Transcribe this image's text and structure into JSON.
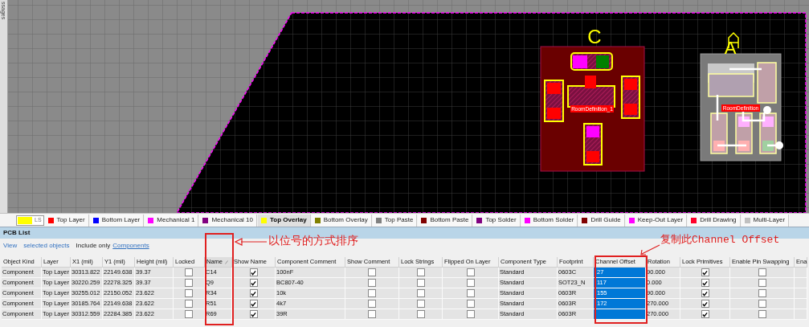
{
  "side_panel": {
    "tab": "ssages"
  },
  "canvas": {
    "components": [
      {
        "kind": "transistor_group",
        "designator": "C",
        "room_label": "RoomDefinition_1",
        "selected": false
      },
      {
        "kind": "resistor_group",
        "designator": "A",
        "room_label": "RoomDefinition",
        "selected": true
      }
    ]
  },
  "current_layer": {
    "label": "LS",
    "color": "#ffff00"
  },
  "layer_tabs": [
    {
      "label": "Top Layer",
      "color": "#ff0000",
      "selected": false
    },
    {
      "label": "Bottom Layer",
      "color": "#0000ff",
      "selected": false
    },
    {
      "label": "Mechanical 1",
      "color": "#ff00ff",
      "selected": false
    },
    {
      "label": "Mechanical 10",
      "color": "#800080",
      "selected": false
    },
    {
      "label": "Top Overlay",
      "color": "#ffff00",
      "selected": true
    },
    {
      "label": "Bottom Overlay",
      "color": "#808000",
      "selected": false
    },
    {
      "label": "Top Paste",
      "color": "#808080",
      "selected": false
    },
    {
      "label": "Bottom Paste",
      "color": "#800000",
      "selected": false
    },
    {
      "label": "Top Solder",
      "color": "#800080",
      "selected": false
    },
    {
      "label": "Bottom Solder",
      "color": "#ff00ff",
      "selected": false
    },
    {
      "label": "Drill Guide",
      "color": "#800000",
      "selected": false
    },
    {
      "label": "Keep-Out Layer",
      "color": "#ff00ff",
      "selected": false
    },
    {
      "label": "Drill Drawing",
      "color": "#ff002a",
      "selected": false
    },
    {
      "label": "Multi-Layer",
      "color": "#c0c0c0",
      "selected": false
    }
  ],
  "panel": {
    "title": "PCB List",
    "filter": {
      "view": "View",
      "scope": "selected objects",
      "include_label": "Include only",
      "include_link": "Components"
    }
  },
  "table": {
    "columns": [
      {
        "label": "Object Kind",
        "kind": "text",
        "sorted": false,
        "selected": false
      },
      {
        "label": "Layer",
        "kind": "text",
        "sorted": false,
        "selected": false
      },
      {
        "label": "X1 (mil)",
        "kind": "text",
        "sorted": false,
        "selected": false
      },
      {
        "label": "Y1 (mil)",
        "kind": "text",
        "sorted": false,
        "selected": false
      },
      {
        "label": "Height (mil)",
        "kind": "text",
        "sorted": false,
        "selected": false
      },
      {
        "label": "Locked",
        "kind": "check",
        "sorted": false,
        "selected": false
      },
      {
        "label": "Name",
        "kind": "text",
        "sorted": true,
        "selected": false
      },
      {
        "label": "Show Name",
        "kind": "check",
        "sorted": false,
        "selected": false
      },
      {
        "label": "Component Comment",
        "kind": "text",
        "sorted": false,
        "selected": false
      },
      {
        "label": "Show Comment",
        "kind": "check",
        "sorted": false,
        "selected": false
      },
      {
        "label": "Lock Strings",
        "kind": "check",
        "sorted": false,
        "selected": false
      },
      {
        "label": "Flipped On Layer",
        "kind": "check",
        "sorted": false,
        "selected": false
      },
      {
        "label": "Component Type",
        "kind": "text",
        "sorted": false,
        "selected": false
      },
      {
        "label": "Footprint",
        "kind": "text",
        "sorted": false,
        "selected": false
      },
      {
        "label": "Channel Offset",
        "kind": "text",
        "sorted": false,
        "selected": true
      },
      {
        "label": "Rotation",
        "kind": "text",
        "sorted": false,
        "selected": false
      },
      {
        "label": "Lock Primitives",
        "kind": "check",
        "sorted": false,
        "selected": false
      },
      {
        "label": "Enable Pin Swapping",
        "kind": "check",
        "sorted": false,
        "selected": false
      },
      {
        "label": "Ena",
        "kind": "text",
        "sorted": false,
        "selected": false
      }
    ],
    "rows": [
      {
        "cells": [
          {
            "text": "Component"
          },
          {
            "text": "Top Layer"
          },
          {
            "text": "30313.822"
          },
          {
            "text": "22149.638"
          },
          {
            "text": "39.37"
          },
          {
            "checked": false
          },
          {
            "text": "C14"
          },
          {
            "checked": true
          },
          {
            "text": "100nF"
          },
          {
            "checked": false
          },
          {
            "checked": false
          },
          {
            "checked": false
          },
          {
            "text": "Standard"
          },
          {
            "text": "0603C"
          },
          {
            "text": "27"
          },
          {
            "text": "90.000"
          },
          {
            "checked": true
          },
          {
            "checked": false
          }
        ]
      },
      {
        "cells": [
          {
            "text": "Component"
          },
          {
            "text": "Top Layer"
          },
          {
            "text": "30220.259"
          },
          {
            "text": "22278.325"
          },
          {
            "text": "39.37"
          },
          {
            "checked": false
          },
          {
            "text": "Q9"
          },
          {
            "checked": true
          },
          {
            "text": "BC807-40"
          },
          {
            "checked": false
          },
          {
            "checked": false
          },
          {
            "checked": false
          },
          {
            "text": "Standard"
          },
          {
            "text": "SOT23_N"
          },
          {
            "text": "117"
          },
          {
            "text": "0.000"
          },
          {
            "checked": true
          },
          {
            "checked": false
          }
        ]
      },
      {
        "cells": [
          {
            "text": "Component"
          },
          {
            "text": "Top Layer"
          },
          {
            "text": "30255.012"
          },
          {
            "text": "22150.052"
          },
          {
            "text": "23.622"
          },
          {
            "checked": false
          },
          {
            "text": "R34"
          },
          {
            "checked": true
          },
          {
            "text": "10k"
          },
          {
            "checked": false
          },
          {
            "checked": false
          },
          {
            "checked": false
          },
          {
            "text": "Standard"
          },
          {
            "text": "0603R"
          },
          {
            "text": "155"
          },
          {
            "text": "90.000"
          },
          {
            "checked": true
          },
          {
            "checked": false
          }
        ]
      },
      {
        "cells": [
          {
            "text": "Component"
          },
          {
            "text": "Top Layer"
          },
          {
            "text": "30185.764"
          },
          {
            "text": "22149.638"
          },
          {
            "text": "23.622"
          },
          {
            "checked": false
          },
          {
            "text": "R51"
          },
          {
            "checked": true
          },
          {
            "text": "4k7"
          },
          {
            "checked": false
          },
          {
            "checked": false
          },
          {
            "checked": false
          },
          {
            "text": "Standard"
          },
          {
            "text": "0603R"
          },
          {
            "text": "172"
          },
          {
            "text": "270.000"
          },
          {
            "checked": true
          },
          {
            "checked": false
          }
        ]
      },
      {
        "cells": [
          {
            "text": "Component"
          },
          {
            "text": "Top Layer"
          },
          {
            "text": "30312.559"
          },
          {
            "text": "22284.385"
          },
          {
            "text": "23.622"
          },
          {
            "checked": false
          },
          {
            "text": "R69"
          },
          {
            "checked": true
          },
          {
            "text": "39R"
          },
          {
            "checked": false
          },
          {
            "checked": false
          },
          {
            "checked": false
          },
          {
            "text": "Standard"
          },
          {
            "text": "0603R"
          },
          {},
          {
            "text": "270.000"
          },
          {
            "checked": true
          },
          {
            "checked": false
          }
        ]
      }
    ]
  },
  "annotations": [
    {
      "text": "以位号的方式排序"
    },
    {
      "text": "复制此Channel Offset"
    }
  ]
}
